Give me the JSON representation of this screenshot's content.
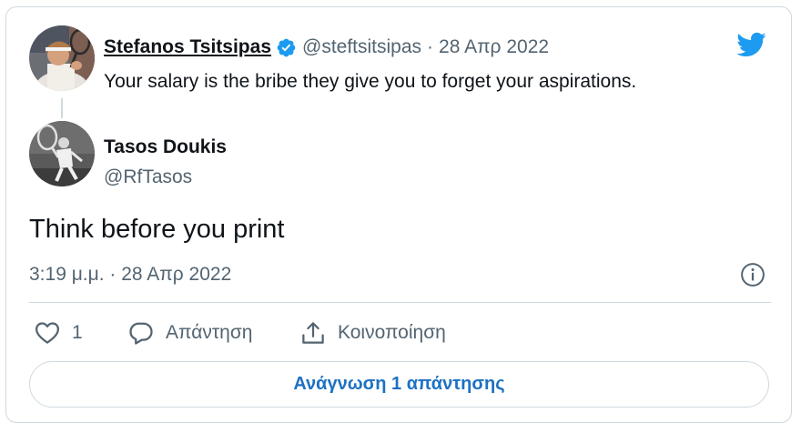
{
  "colors": {
    "twitter_blue": "#1d9bf0",
    "link_blue": "#1d71c3",
    "text_primary": "#0f1419",
    "text_secondary": "#536471",
    "border": "#cfd9de"
  },
  "icons": {
    "logo": "twitter-bird-icon",
    "verified": "verified-badge-icon",
    "info": "info-icon",
    "like": "heart-icon",
    "reply": "speech-bubble-icon",
    "share": "share-upload-icon"
  },
  "quoted_tweet": {
    "author_name": "Stefanos Tsitsipas",
    "handle": "@steftsitsipas",
    "separator": "·",
    "date": "28 Απρ 2022",
    "text": "Your salary is the bribe they give you to forget your aspirations."
  },
  "tweet": {
    "author_name": "Tasos Doukis",
    "handle": "@RfTasos",
    "text": "Think before you print",
    "timestamp": "3:19 μ.μ. · 28 Απρ 2022"
  },
  "actions": {
    "like_count": "1",
    "reply_label": "Απάντηση",
    "share_label": "Κοινοποίηση"
  },
  "read_replies_label": "Ανάγνωση 1 απάντησης"
}
